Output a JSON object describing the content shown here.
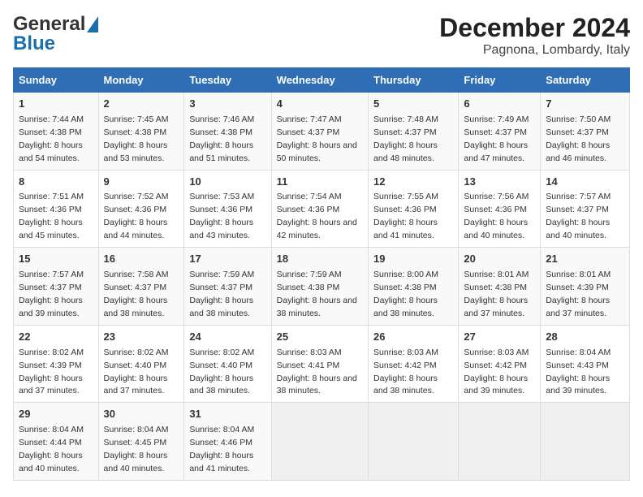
{
  "logo": {
    "part1": "General",
    "part2": "Blue"
  },
  "title": "December 2024",
  "subtitle": "Pagnona, Lombardy, Italy",
  "days_of_week": [
    "Sunday",
    "Monday",
    "Tuesday",
    "Wednesday",
    "Thursday",
    "Friday",
    "Saturday"
  ],
  "weeks": [
    [
      {
        "day": "1",
        "sunrise": "7:44 AM",
        "sunset": "4:38 PM",
        "daylight": "8 hours and 54 minutes."
      },
      {
        "day": "2",
        "sunrise": "7:45 AM",
        "sunset": "4:38 PM",
        "daylight": "8 hours and 53 minutes."
      },
      {
        "day": "3",
        "sunrise": "7:46 AM",
        "sunset": "4:38 PM",
        "daylight": "8 hours and 51 minutes."
      },
      {
        "day": "4",
        "sunrise": "7:47 AM",
        "sunset": "4:37 PM",
        "daylight": "8 hours and 50 minutes."
      },
      {
        "day": "5",
        "sunrise": "7:48 AM",
        "sunset": "4:37 PM",
        "daylight": "8 hours and 48 minutes."
      },
      {
        "day": "6",
        "sunrise": "7:49 AM",
        "sunset": "4:37 PM",
        "daylight": "8 hours and 47 minutes."
      },
      {
        "day": "7",
        "sunrise": "7:50 AM",
        "sunset": "4:37 PM",
        "daylight": "8 hours and 46 minutes."
      }
    ],
    [
      {
        "day": "8",
        "sunrise": "7:51 AM",
        "sunset": "4:36 PM",
        "daylight": "8 hours and 45 minutes."
      },
      {
        "day": "9",
        "sunrise": "7:52 AM",
        "sunset": "4:36 PM",
        "daylight": "8 hours and 44 minutes."
      },
      {
        "day": "10",
        "sunrise": "7:53 AM",
        "sunset": "4:36 PM",
        "daylight": "8 hours and 43 minutes."
      },
      {
        "day": "11",
        "sunrise": "7:54 AM",
        "sunset": "4:36 PM",
        "daylight": "8 hours and 42 minutes."
      },
      {
        "day": "12",
        "sunrise": "7:55 AM",
        "sunset": "4:36 PM",
        "daylight": "8 hours and 41 minutes."
      },
      {
        "day": "13",
        "sunrise": "7:56 AM",
        "sunset": "4:36 PM",
        "daylight": "8 hours and 40 minutes."
      },
      {
        "day": "14",
        "sunrise": "7:57 AM",
        "sunset": "4:37 PM",
        "daylight": "8 hours and 40 minutes."
      }
    ],
    [
      {
        "day": "15",
        "sunrise": "7:57 AM",
        "sunset": "4:37 PM",
        "daylight": "8 hours and 39 minutes."
      },
      {
        "day": "16",
        "sunrise": "7:58 AM",
        "sunset": "4:37 PM",
        "daylight": "8 hours and 38 minutes."
      },
      {
        "day": "17",
        "sunrise": "7:59 AM",
        "sunset": "4:37 PM",
        "daylight": "8 hours and 38 minutes."
      },
      {
        "day": "18",
        "sunrise": "7:59 AM",
        "sunset": "4:38 PM",
        "daylight": "8 hours and 38 minutes."
      },
      {
        "day": "19",
        "sunrise": "8:00 AM",
        "sunset": "4:38 PM",
        "daylight": "8 hours and 38 minutes."
      },
      {
        "day": "20",
        "sunrise": "8:01 AM",
        "sunset": "4:38 PM",
        "daylight": "8 hours and 37 minutes."
      },
      {
        "day": "21",
        "sunrise": "8:01 AM",
        "sunset": "4:39 PM",
        "daylight": "8 hours and 37 minutes."
      }
    ],
    [
      {
        "day": "22",
        "sunrise": "8:02 AM",
        "sunset": "4:39 PM",
        "daylight": "8 hours and 37 minutes."
      },
      {
        "day": "23",
        "sunrise": "8:02 AM",
        "sunset": "4:40 PM",
        "daylight": "8 hours and 37 minutes."
      },
      {
        "day": "24",
        "sunrise": "8:02 AM",
        "sunset": "4:40 PM",
        "daylight": "8 hours and 38 minutes."
      },
      {
        "day": "25",
        "sunrise": "8:03 AM",
        "sunset": "4:41 PM",
        "daylight": "8 hours and 38 minutes."
      },
      {
        "day": "26",
        "sunrise": "8:03 AM",
        "sunset": "4:42 PM",
        "daylight": "8 hours and 38 minutes."
      },
      {
        "day": "27",
        "sunrise": "8:03 AM",
        "sunset": "4:42 PM",
        "daylight": "8 hours and 39 minutes."
      },
      {
        "day": "28",
        "sunrise": "8:04 AM",
        "sunset": "4:43 PM",
        "daylight": "8 hours and 39 minutes."
      }
    ],
    [
      {
        "day": "29",
        "sunrise": "8:04 AM",
        "sunset": "4:44 PM",
        "daylight": "8 hours and 40 minutes."
      },
      {
        "day": "30",
        "sunrise": "8:04 AM",
        "sunset": "4:45 PM",
        "daylight": "8 hours and 40 minutes."
      },
      {
        "day": "31",
        "sunrise": "8:04 AM",
        "sunset": "4:46 PM",
        "daylight": "8 hours and 41 minutes."
      },
      null,
      null,
      null,
      null
    ]
  ]
}
